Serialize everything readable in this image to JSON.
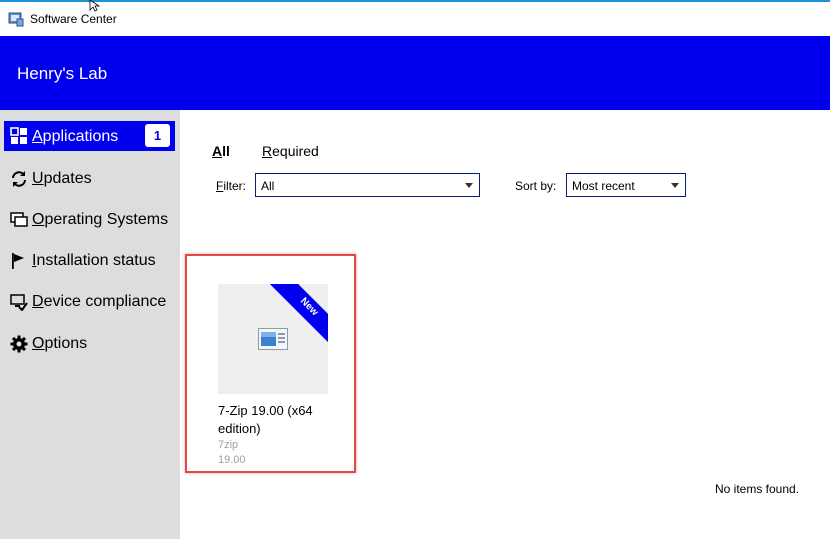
{
  "window": {
    "title": "Software Center",
    "icon": "software-center-icon"
  },
  "header": {
    "org_name": "Henry's Lab",
    "background": "#0000ee"
  },
  "sidebar": {
    "items": [
      {
        "label": "Applications",
        "icon": "applications-grid-icon",
        "badge": "1",
        "active": true
      },
      {
        "label": "Updates",
        "icon": "refresh-icon"
      },
      {
        "label": "Operating Systems",
        "icon": "windows-stack-icon"
      },
      {
        "label": "Installation status",
        "icon": "flag-icon"
      },
      {
        "label": "Device compliance",
        "icon": "device-check-icon"
      },
      {
        "label": "Options",
        "icon": "gear-icon"
      }
    ]
  },
  "tabs": [
    {
      "label": "All",
      "active": true
    },
    {
      "label": "Required"
    }
  ],
  "filter": {
    "label": "Filter:",
    "value": "All"
  },
  "sort": {
    "label": "Sort by:",
    "value": "Most recent"
  },
  "apps": [
    {
      "name": "7-Zip 19.00 (x64 edition)",
      "publisher": "7zip",
      "version": "19.00",
      "ribbon": "New"
    }
  ],
  "status": {
    "empty_message": "No items found."
  },
  "colors": {
    "accent": "#0000ee",
    "sidebar": "#dddddd",
    "highlight": "#e04848"
  }
}
